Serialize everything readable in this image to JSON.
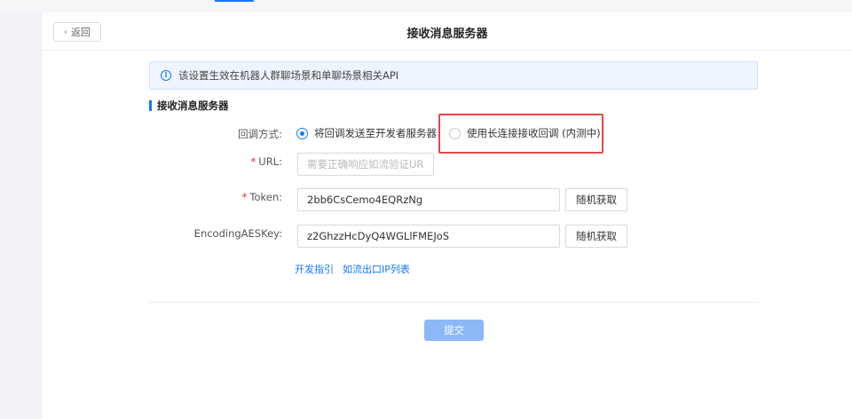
{
  "header": {
    "back_label": "返回",
    "title": "接收消息服务器"
  },
  "notice": {
    "text": "该设置生效在机器人群聊场景和单聊场景相关API"
  },
  "section": {
    "title": "接收消息服务器"
  },
  "form": {
    "callback_label": "回调方式:",
    "callback_options": [
      {
        "label": "将回调发送至开发者服务器",
        "checked": true
      },
      {
        "label": "使用长连接接收回调 (内测中)",
        "checked": false
      }
    ],
    "url_required": "*",
    "url_label": "URL:",
    "url_placeholder": "需要正确响应如流验证URL请求",
    "url_value": "",
    "token_required": "*",
    "token_label": "Token:",
    "token_value": "2bb6CsCemo4EQRzNg",
    "token_random_label": "随机获取",
    "aes_label": "EncodingAESKey:",
    "aes_value": "z2GhzzHcDyQ4WGLlFMEJoS",
    "aes_random_label": "随机获取"
  },
  "links": {
    "dev_guide": "开发指引",
    "ip_list": "如流出口IP列表"
  },
  "submit_label": "提交",
  "colors": {
    "accent": "#1677ff",
    "highlight": "#e24a4a",
    "submit_disabled": "#8cb8f7"
  }
}
